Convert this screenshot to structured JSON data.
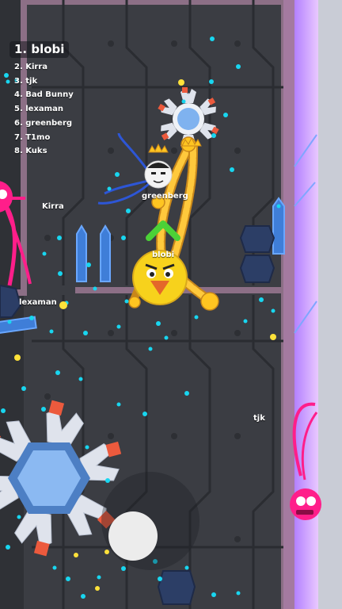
{
  "leaderboard": {
    "first": "1. blobi",
    "rest": [
      "2. Kirra",
      "3. tjk",
      "4. Bad Bunny",
      "5. lexaman",
      "6. greenberg",
      "7. T1mo",
      "8. Kuks"
    ]
  },
  "players": {
    "blobi": "blobi",
    "greenberg": "greenberg",
    "kirra": "Kirra",
    "lexaman": "lexaman",
    "tjk": "tjk"
  },
  "colors": {
    "background": "#2f3136",
    "wall_panel": "#3e4046",
    "wall_border": "#8c6f86",
    "right_wall": "#d4a2ff",
    "player_body": "#f7d21c",
    "player_beak": "#e4672a",
    "crown": "#ffc521",
    "arrow": "#4cd137",
    "pellet": "#18d6f0",
    "hazard_ring": "#4d7fc4",
    "hazard_tip": "#ec5a3d",
    "enemy_pink": "#ff1e8a",
    "joystick": "#ececec"
  },
  "icons": [
    "crown-icon",
    "direction-arrow-icon",
    "joystick-thumb-icon"
  ]
}
